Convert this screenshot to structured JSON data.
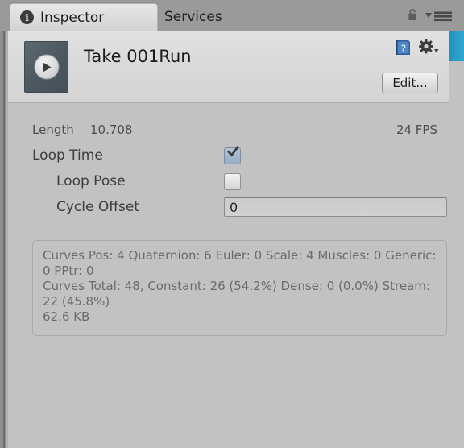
{
  "window": {
    "tabs": [
      {
        "label": "Inspector",
        "icon": "info-icon",
        "active": true
      },
      {
        "label": "Services",
        "icon": "",
        "active": false
      }
    ],
    "lock_icon": "lock-icon",
    "menu_icon": "hamburger-menu-icon",
    "accent_color": "#2ba0cc",
    "panel_bg": "#c2c2c2"
  },
  "header": {
    "title": "Take 001Run",
    "preview_icon": "play-icon",
    "help_icon": "help-book-icon",
    "gear_icon": "gear-icon",
    "edit_label": "Edit..."
  },
  "properties": {
    "length_label": "Length",
    "length_value": "10.708",
    "fps_value": "24 FPS",
    "loop_time_label": "Loop Time",
    "loop_time_checked": "true",
    "loop_pose_label": "Loop Pose",
    "loop_pose_checked": "false",
    "cycle_offset_label": "Cycle Offset",
    "cycle_offset_value": "0"
  },
  "info_box": {
    "lines": [
      "Curves Pos: 4 Quaternion: 6 Euler: 0 Scale: 4 Muscles: 0 Generic: 0 PPtr: 0",
      "Curves Total: 48, Constant: 26 (54.2%) Dense: 0 (0.0%) Stream: 22 (45.8%)",
      "62.6 KB"
    ]
  }
}
